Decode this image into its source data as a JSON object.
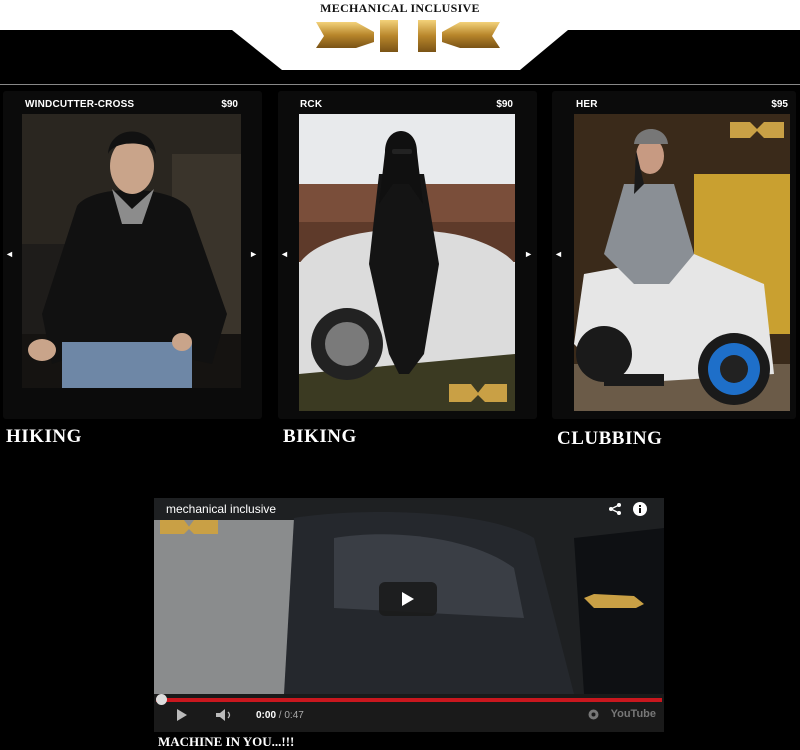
{
  "header": {
    "brand": "MECHANICAL INCLUSIVE"
  },
  "products": [
    {
      "name": "WINDCUTTER-CROSS",
      "price": "$90",
      "category": "HIKING"
    },
    {
      "name": "RCK",
      "price": "$90",
      "category": "BIKING"
    },
    {
      "name": "HER",
      "price": "$95",
      "category": "CLUBBING"
    }
  ],
  "carousel": {
    "prev_glyph": "◄",
    "next_glyph": "►"
  },
  "video": {
    "title": "mechanical inclusive",
    "current_time": "0:00",
    "separator": " / ",
    "duration": "0:47",
    "brand_logo": "YouTube",
    "progress": 0.0
  },
  "footer": {
    "tagline": "MACHINE IN YOU...!!!"
  },
  "colors": {
    "background": "#000000",
    "accent_gold": "#c9a045",
    "progress_red": "#c9171e"
  }
}
